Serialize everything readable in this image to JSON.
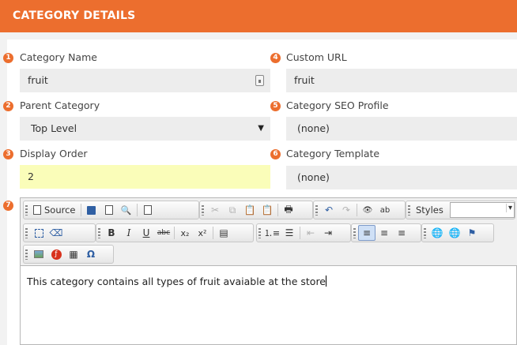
{
  "header": {
    "title": "CATEGORY DETAILS"
  },
  "fields": {
    "category_name": {
      "num": "1",
      "label": "Category Name",
      "value": "fruit"
    },
    "parent_category": {
      "num": "2",
      "label": "Parent Category",
      "value": "Top Level"
    },
    "display_order": {
      "num": "3",
      "label": "Display Order",
      "value": "2"
    },
    "custom_url": {
      "num": "4",
      "label": "Custom URL",
      "value": "fruit"
    },
    "seo_profile": {
      "num": "5",
      "label": "Category SEO Profile",
      "value": "(none)"
    },
    "template": {
      "num": "6",
      "label": "Category Template",
      "value": "(none)"
    }
  },
  "editor": {
    "num": "7",
    "source_label": "Source",
    "styles_label": "Styles",
    "content": "This category contains all types of fruit avaiable at the store"
  },
  "colors": {
    "accent": "#ec6e2e",
    "highlight": "#fafdb9",
    "field_bg": "#ededed"
  }
}
